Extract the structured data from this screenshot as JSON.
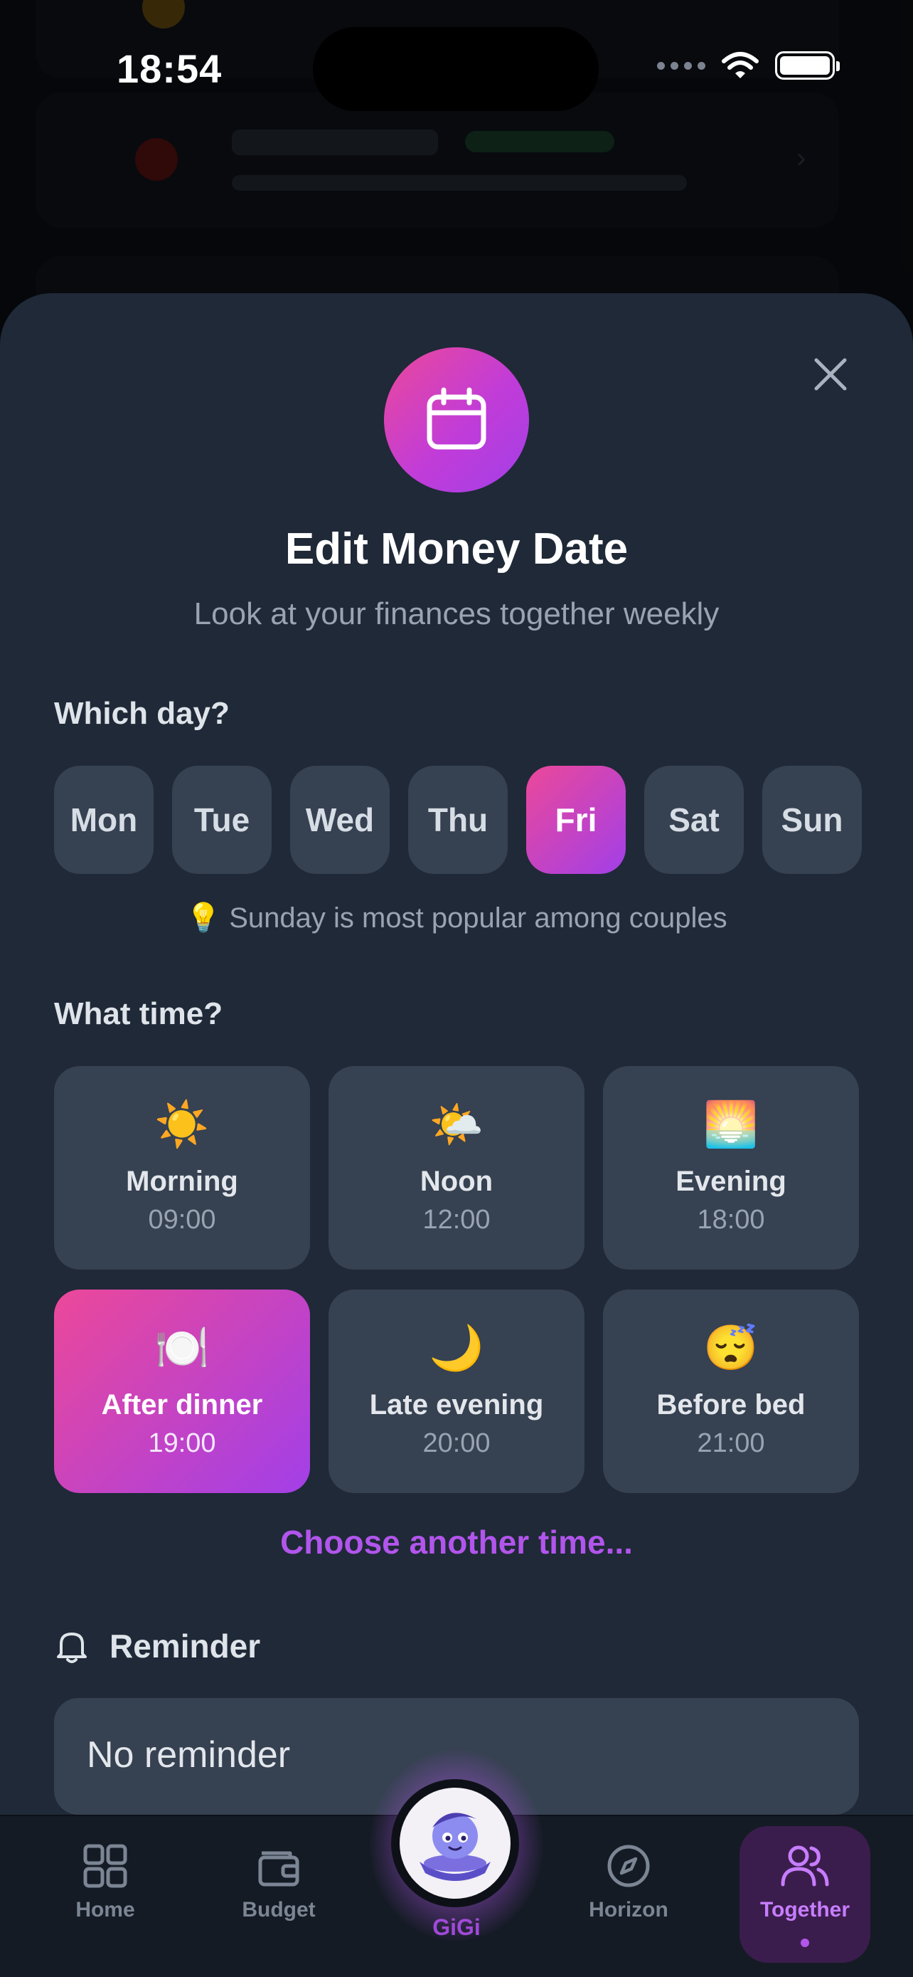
{
  "status_bar": {
    "time": "18:54"
  },
  "dialog": {
    "title": "Edit Money Date",
    "subtitle": "Look at your finances together weekly",
    "close_icon": "close-icon",
    "header_icon": "calendar-icon"
  },
  "day_section": {
    "label": "Which day?",
    "days": [
      {
        "label": "Mon",
        "selected": false
      },
      {
        "label": "Tue",
        "selected": false
      },
      {
        "label": "Wed",
        "selected": false
      },
      {
        "label": "Thu",
        "selected": false
      },
      {
        "label": "Fri",
        "selected": true
      },
      {
        "label": "Sat",
        "selected": false
      },
      {
        "label": "Sun",
        "selected": false
      }
    ],
    "hint": "💡 Sunday is most popular among couples"
  },
  "time_section": {
    "label": "What time?",
    "options": [
      {
        "emoji": "☀️",
        "name": "Morning",
        "time": "09:00",
        "selected": false
      },
      {
        "emoji": "🌤️",
        "name": "Noon",
        "time": "12:00",
        "selected": false
      },
      {
        "emoji": "🌅",
        "name": "Evening",
        "time": "18:00",
        "selected": false
      },
      {
        "emoji": "🍽️",
        "name": "After dinner",
        "time": "19:00",
        "selected": true
      },
      {
        "emoji": "🌙",
        "name": "Late evening",
        "time": "20:00",
        "selected": false
      },
      {
        "emoji": "😴",
        "name": "Before bed",
        "time": "21:00",
        "selected": false
      }
    ],
    "custom_link": "Choose another time..."
  },
  "reminder": {
    "label": "Reminder",
    "icon": "bell-icon",
    "value": "No reminder"
  },
  "bottom_nav": {
    "items": [
      {
        "label": "Home",
        "icon": "grid-icon",
        "active": false
      },
      {
        "label": "Budget",
        "icon": "wallet-icon",
        "active": false
      },
      {
        "label": "GiGi",
        "icon": "gigi-avatar",
        "active": false
      },
      {
        "label": "Horizon",
        "icon": "compass-icon",
        "active": false
      },
      {
        "label": "Together",
        "icon": "users-icon",
        "active": true
      }
    ]
  },
  "colors": {
    "accent_gradient_start": "#ec4899",
    "accent_gradient_end": "#a23fe8",
    "accent_text": "#b255ec",
    "sheet_bg": "#1f2937",
    "tile_bg": "#364151"
  }
}
